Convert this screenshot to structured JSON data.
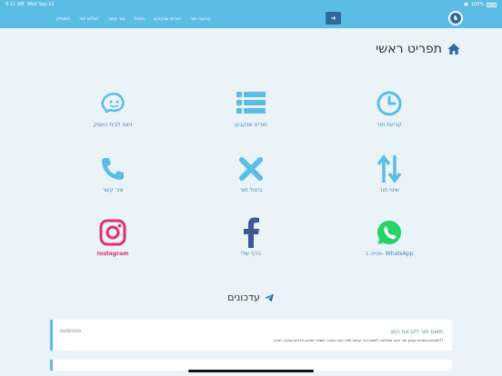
{
  "status_bar": {
    "time": "9:11 AM",
    "date": "Wed Sep 11",
    "battery": "100%",
    "wifi_icon": "wifi-icon",
    "battery_icon": "battery-icon"
  },
  "navbar": {
    "logo_icon": "brand-logo-icon",
    "toggle_icon": "arrow-right-icon",
    "links": [
      "קביעת תור",
      "תורים שנקבעו",
      "ביטול",
      "צור קשר",
      "שלום יוסי!",
      "התנתק"
    ]
  },
  "page_title": "תפריט ראשי",
  "tiles": [
    {
      "label": "קביעת תור",
      "icon": "clock-icon"
    },
    {
      "label": "תורים שנקבעו",
      "icon": "list-icon"
    },
    {
      "label": "ניווט לבית העסק",
      "icon": "waze-icon"
    },
    {
      "label": "שינוי תור",
      "icon": "swap-arrows-icon"
    },
    {
      "label": "ביטול תור",
      "icon": "x-icon"
    },
    {
      "label": "צור קשר",
      "icon": "phone-icon"
    },
    {
      "label": "פנייה ב- WhatsApp",
      "icon": "whatsapp-icon"
    },
    {
      "label": "הדף שלי",
      "icon": "facebook-icon"
    },
    {
      "label": "Instagram",
      "icon": "instagram-icon"
    }
  ],
  "updates": {
    "title": "עדכונים",
    "items": [
      {
        "title": "תאום תור לקראת החג",
        "date": "04/09/2019",
        "body": "לקוחות אשרים קבוע תור הבא ממליצה לתאם כבר עכשיו לפני החג הקרב. מספר תורים בודדים נשארו, תודה!!"
      }
    ]
  },
  "colors": {
    "primary": "#5bbde6",
    "dark": "#2f6a9c",
    "background": "#eaf3f8",
    "whatsapp": "#25d366",
    "facebook": "#3b5998",
    "instagram": "#e1306c"
  }
}
